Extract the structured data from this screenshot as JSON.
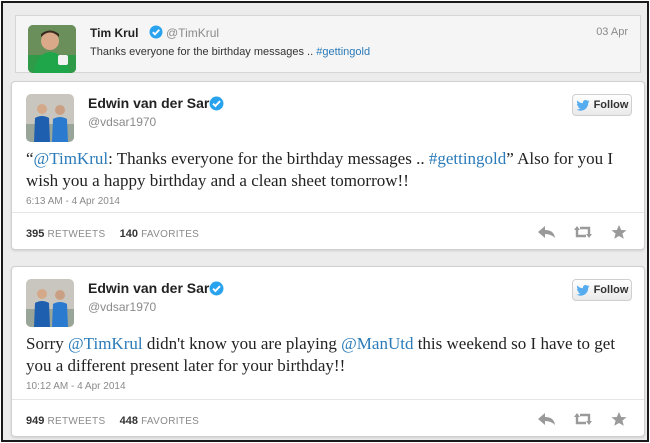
{
  "context_tweet": {
    "name": "Tim Krul",
    "handle": "@TimKrul",
    "date": "03 Apr",
    "text": "Thanks everyone for the birthday messages .. ",
    "hashtag": "#gettingold"
  },
  "tweets": [
    {
      "name": "Edwin van der Sar",
      "handle": "@vdsar1970",
      "follow_label": "Follow",
      "text_open_quote": "“",
      "mention_1": "@TimKrul",
      "text_1": ": Thanks everyone for the birthday messages .. ",
      "hashtag": "#gettingold",
      "text_2": "” Also for you I wish you a happy birthday and a clean sheet tomorrow!!",
      "timestamp": "6:13 AM - 4 Apr 2014",
      "retweets": "395",
      "retweets_label": "RETWEETS",
      "favorites": "140",
      "favorites_label": "FAVORITES"
    },
    {
      "name": "Edwin van der Sar",
      "handle": "@vdsar1970",
      "follow_label": "Follow",
      "text_1": "Sorry ",
      "mention_1": "@TimKrul",
      "text_2": " didn't know you are playing ",
      "mention_2": "@ManUtd",
      "text_3": " this weekend so I have to get you a different present later for your birthday!!",
      "timestamp": "10:12 AM - 4 Apr 2014",
      "retweets": "949",
      "retweets_label": "RETWEETS",
      "favorites": "448",
      "favorites_label": "FAVORITES"
    }
  ],
  "icons": {
    "verified": "verified-badge-icon",
    "twitter_bird": "twitter-bird-icon",
    "reply": "reply-icon",
    "retweet": "retweet-icon",
    "favorite": "star-icon"
  },
  "colors": {
    "link": "#2b7bb9",
    "verified": "#2aa3ef",
    "twitter_blue": "#55acee",
    "muted_text": "#8a8a8a",
    "action_icon": "#9a9a9a"
  }
}
